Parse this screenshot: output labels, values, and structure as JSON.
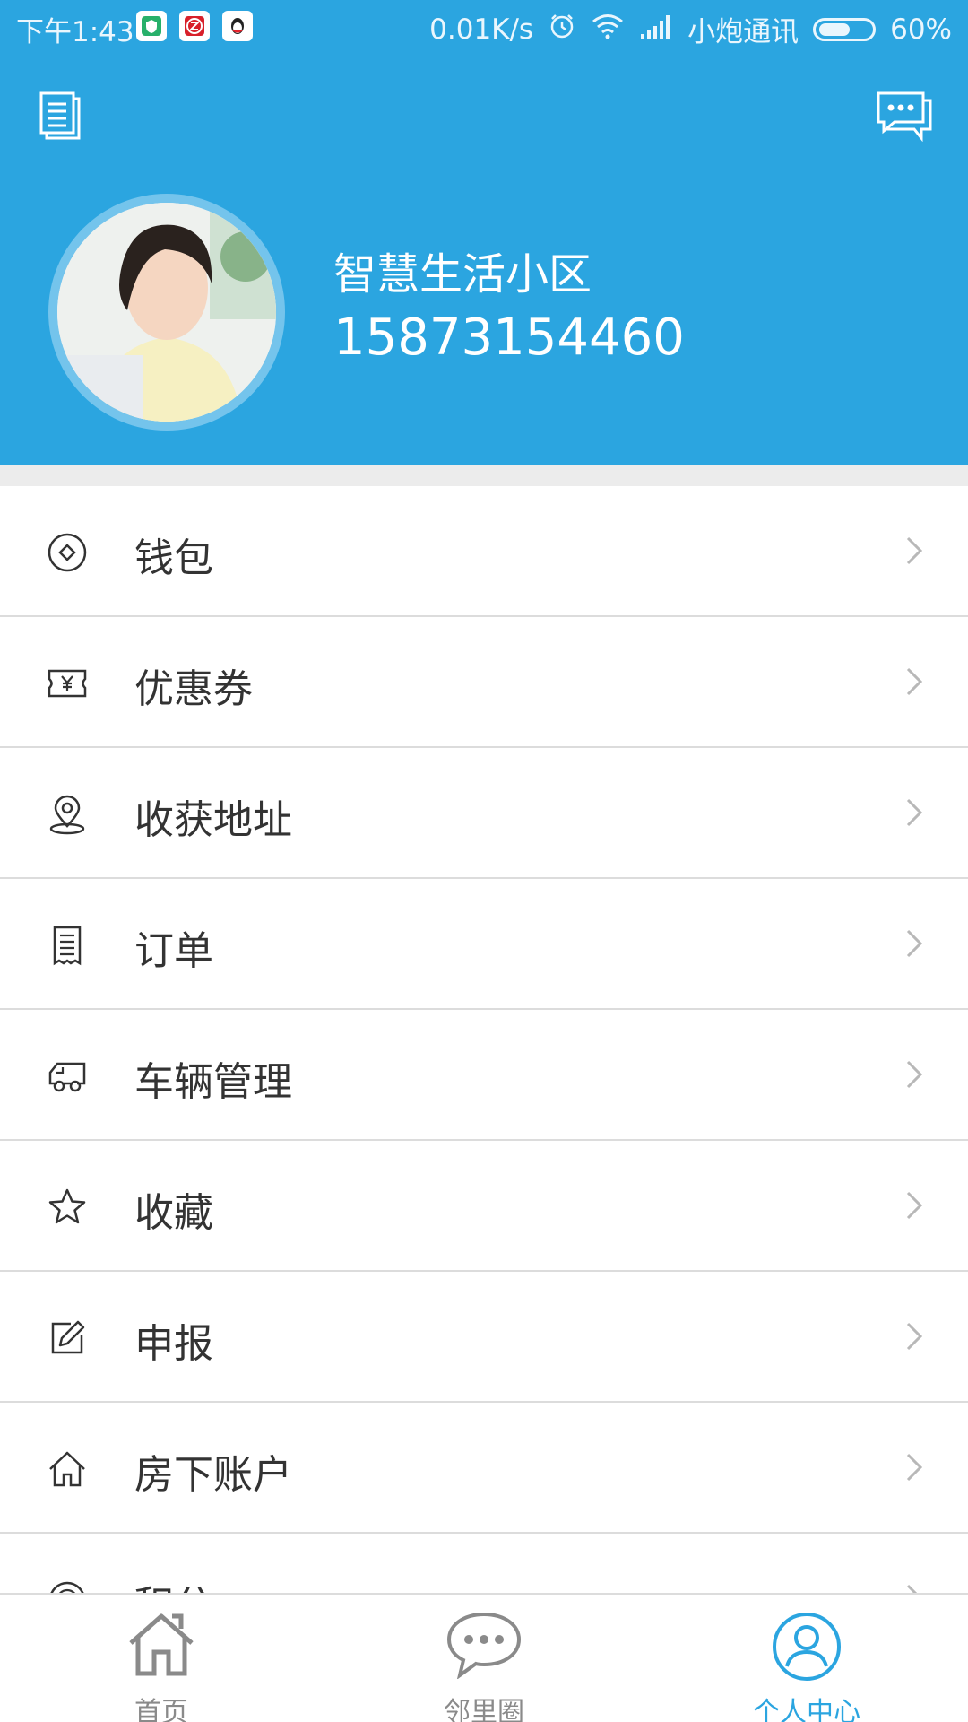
{
  "status_bar": {
    "time": "下午1:43",
    "speed": "0.01K/s",
    "carrier": "小炮通讯",
    "battery_percent": "60%",
    "battery_level": 0.6,
    "icons": [
      "security-app-icon",
      "z-app-icon",
      "qq-app-icon",
      "alarm-icon",
      "wifi-icon",
      "signal-icon",
      "battery-icon"
    ]
  },
  "header": {
    "background_color": "#2ba5e0",
    "left_icon": "document-list-icon",
    "right_icon": "chat-bubbles-icon"
  },
  "profile": {
    "name": "智慧生活小区",
    "phone": "15873154460"
  },
  "menu": [
    {
      "label": "钱包",
      "icon": "wallet-icon"
    },
    {
      "label": "优惠券",
      "icon": "coupon-icon"
    },
    {
      "label": "收获地址",
      "icon": "location-pin-icon"
    },
    {
      "label": "订单",
      "icon": "order-receipt-icon"
    },
    {
      "label": "车辆管理",
      "icon": "vehicle-icon"
    },
    {
      "label": "收藏",
      "icon": "star-icon"
    },
    {
      "label": "申报",
      "icon": "edit-icon"
    },
    {
      "label": "房下账户",
      "icon": "home-icon"
    },
    {
      "label": "积分",
      "icon": "points-icon"
    }
  ],
  "tabs": [
    {
      "label": "首页",
      "icon": "home-tab-icon",
      "active": false
    },
    {
      "label": "邻里圈",
      "icon": "chat-tab-icon",
      "active": false
    },
    {
      "label": "个人中心",
      "icon": "user-tab-icon",
      "active": true
    }
  ],
  "colors": {
    "accent": "#2ba5e0",
    "inactive_tab": "#8a8a8a",
    "divider": "#dcdcdc",
    "text": "#333333"
  }
}
